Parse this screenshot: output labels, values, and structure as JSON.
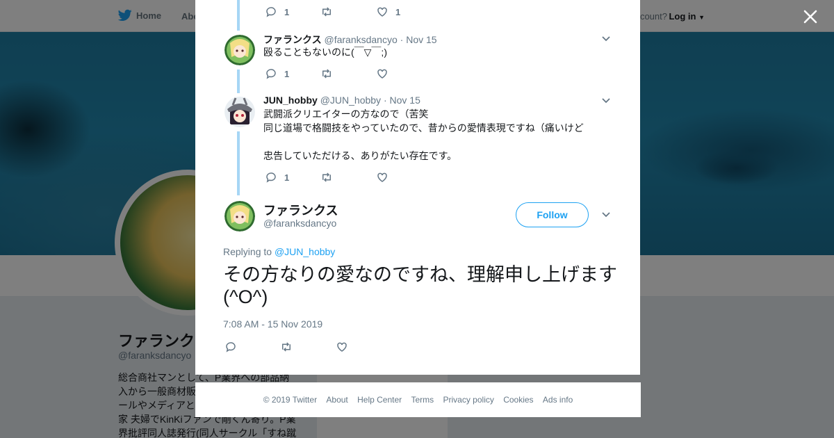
{
  "background": {
    "topbar": {
      "home_label": "Home",
      "about_label": "Abo",
      "have_account_text": "ccount?",
      "login_label": "Log in"
    },
    "profile": {
      "name": "ファランクス",
      "handle": "@faranksdancyo",
      "bio_lines": [
        "総合商社マンとして、P業界への部品納",
        "入から一般商材販",
        "ールやメディアと",
        "家 夫婦でKinKiファンで剛くん寄り。P業",
        "界批評同人誌発行(同人サークル「すね蹴"
      ]
    },
    "card_text": "Ads info"
  },
  "colors": {
    "accent": "#1da1f2",
    "thread_line": "#a6d6f5",
    "muted": "#657786"
  },
  "thread": [
    {
      "name": "",
      "handle": "",
      "time": "",
      "text": "",
      "reply_count": "1",
      "retweet_count": "",
      "like_count": "1"
    },
    {
      "name": "ファランクス",
      "handle": "@faranksdancyo",
      "dot": "·",
      "time": "Nov 15",
      "text": "殴ることもないのに(￣▽￣;)",
      "reply_count": "1",
      "retweet_count": "",
      "like_count": ""
    },
    {
      "name": "JUN_hobby",
      "handle": "@JUN_hobby",
      "dot": "·",
      "time": "Nov 15",
      "text": "武闘派クリエイターの方なので（苦笑\n同じ道場で格闘技をやっていたので、昔からの愛情表現ですね（痛いけど\n\n忠告していただける、ありがたい存在です。",
      "reply_count": "1",
      "retweet_count": "",
      "like_count": ""
    }
  ],
  "main_tweet": {
    "name": "ファランクス",
    "handle": "@faranksdancyo",
    "follow_label": "Follow",
    "replying_prefix": "Replying to",
    "replying_to": "@JUN_hobby",
    "text": "その方なりの愛なのですね、理解申し上げます(^O^)",
    "timestamp": "7:08 AM - 15 Nov 2019"
  },
  "footer": {
    "links": [
      "© 2019 Twitter",
      "About",
      "Help Center",
      "Terms",
      "Privacy policy",
      "Cookies",
      "Ads info"
    ]
  },
  "icons": [
    "twitter-bird-icon",
    "close-icon",
    "reply-icon",
    "retweet-icon",
    "like-icon",
    "chevron-down-icon"
  ]
}
